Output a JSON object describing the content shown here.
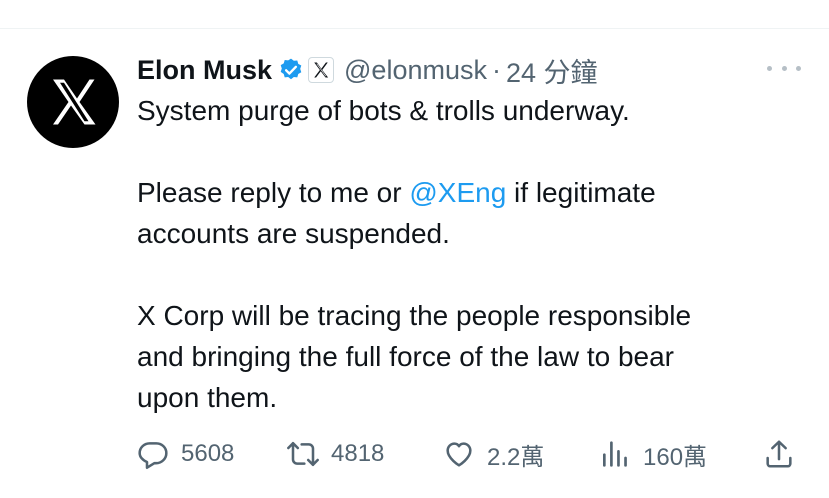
{
  "tweet": {
    "author_name": "Elon Musk",
    "handle": "@elonmusk",
    "separator": "·",
    "time": "24 分鐘",
    "lines": {
      "l1": "System purge of bots & trolls underway.",
      "l2_before": "Please reply to me or ",
      "l2_mention": "@XEng",
      "l2_after": " if legitimate",
      "l3": "accounts are suspended.",
      "l4": "X Corp will be tracing the people responsible",
      "l5": "and bringing the full force of the law to bear",
      "l6": "upon them."
    },
    "metrics": {
      "replies": "5608",
      "reposts": "4818",
      "likes": "2.2萬",
      "views": "160萬"
    }
  },
  "icons": [
    "x-logo-icon",
    "verified-badge-icon",
    "affiliate-x-icon",
    "more-icon",
    "reply-icon",
    "repost-icon",
    "like-icon",
    "views-icon",
    "share-icon"
  ],
  "colors": {
    "text": "#0f1419",
    "secondary": "#536471",
    "link": "#1d9bf0",
    "verified": "#1d9bf0",
    "divider": "#eff3f4"
  }
}
